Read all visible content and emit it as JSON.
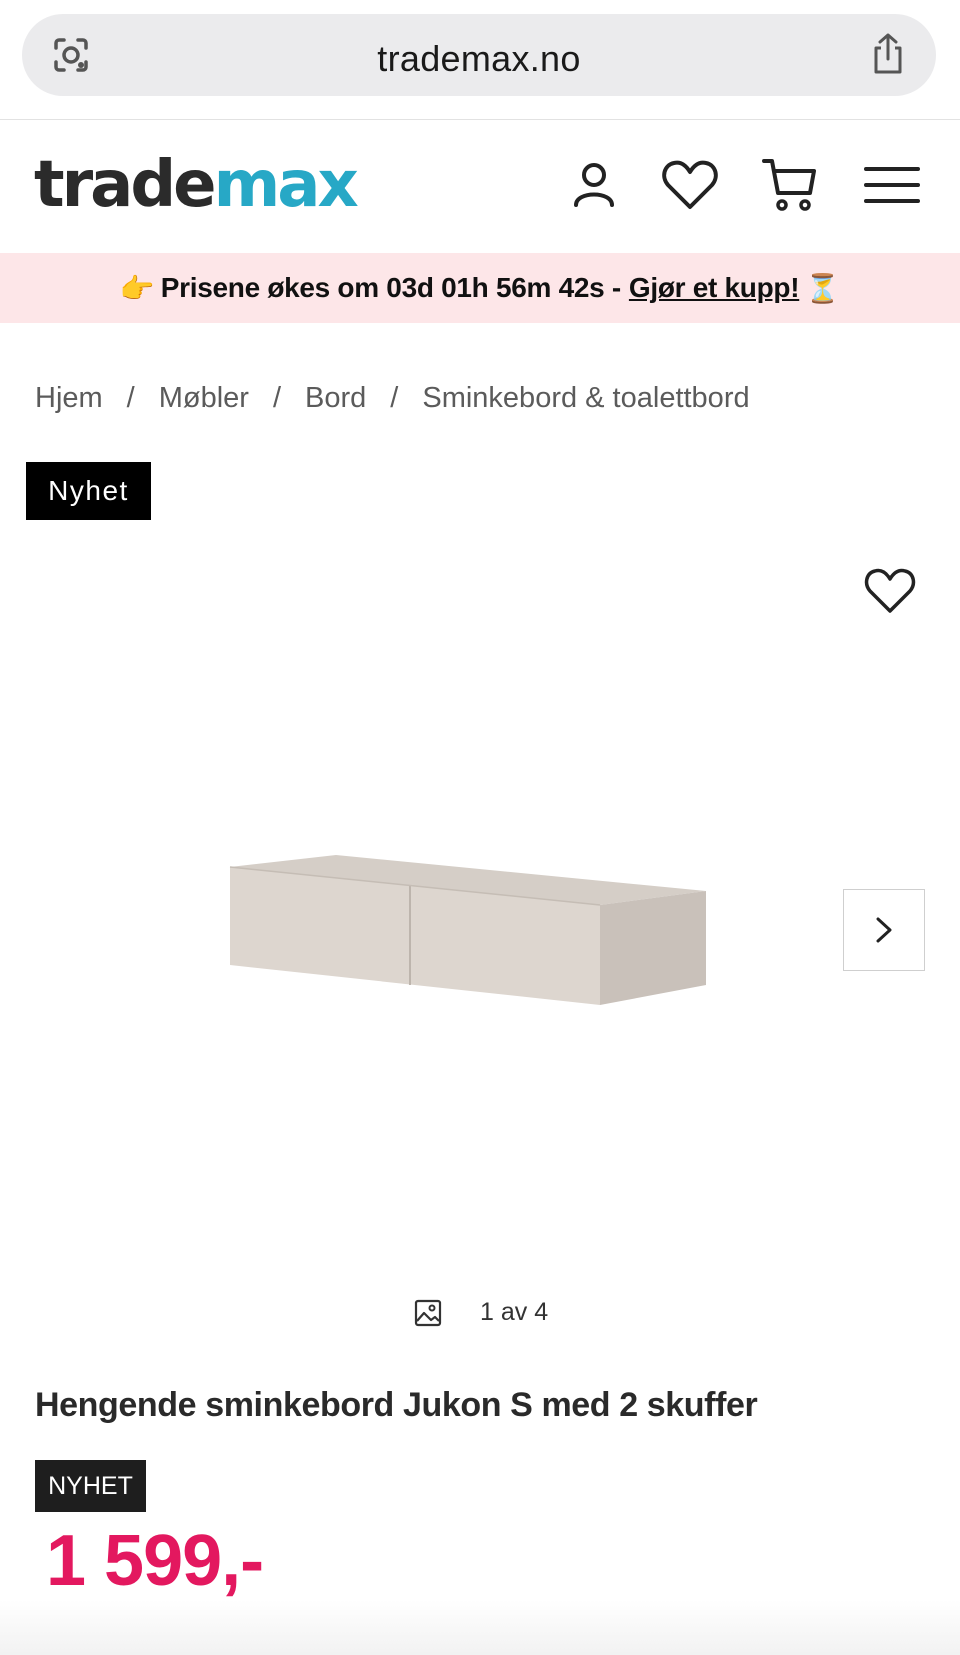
{
  "browser": {
    "url": "trademax.no",
    "icons": [
      "lens-icon",
      "share-icon"
    ]
  },
  "header": {
    "logo_part1": "trade",
    "logo_part2": "max",
    "logo_colors": {
      "trade": "#2b2b2b",
      "max": "#27a8c6"
    },
    "icons": [
      "account-icon",
      "heart-icon",
      "cart-icon",
      "menu-icon"
    ]
  },
  "promo": {
    "text": "Prisene økes om 03d 01h 56m 42s -",
    "link": "Gjør et kupp!",
    "emoji_left": "👉",
    "emoji_right": "⏳",
    "background": "#fde6e8"
  },
  "breadcrumb": {
    "items": [
      "Hjem",
      "Møbler",
      "Bord",
      "Sminkebord & toalettbord"
    ],
    "separator": "/"
  },
  "gallery": {
    "badge": "Nyhet",
    "counter": "1 av 4",
    "icons": [
      "wishlist-heart-icon",
      "chevron-right-icon",
      "gallery-icon"
    ]
  },
  "product": {
    "title": "Hengende sminkebord Jukon S med 2 skuffer",
    "label": "NYHET",
    "price": "1 599,-",
    "price_color": "#e3185f"
  }
}
